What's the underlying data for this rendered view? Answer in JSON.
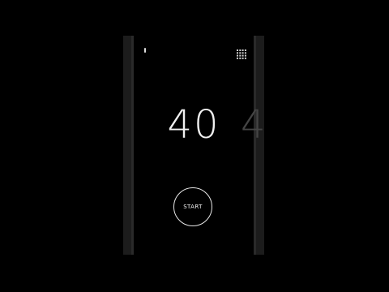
{
  "counter": {
    "value": "40"
  },
  "peek": {
    "digit": "4"
  },
  "controls": {
    "start_label": "START"
  },
  "icons": {
    "top_left": "status-mark-icon",
    "top_right": "grid-menu-icon"
  },
  "colors": {
    "background": "#000000",
    "foreground": "#f0f0f0",
    "bezel": "#1c1c1c"
  }
}
